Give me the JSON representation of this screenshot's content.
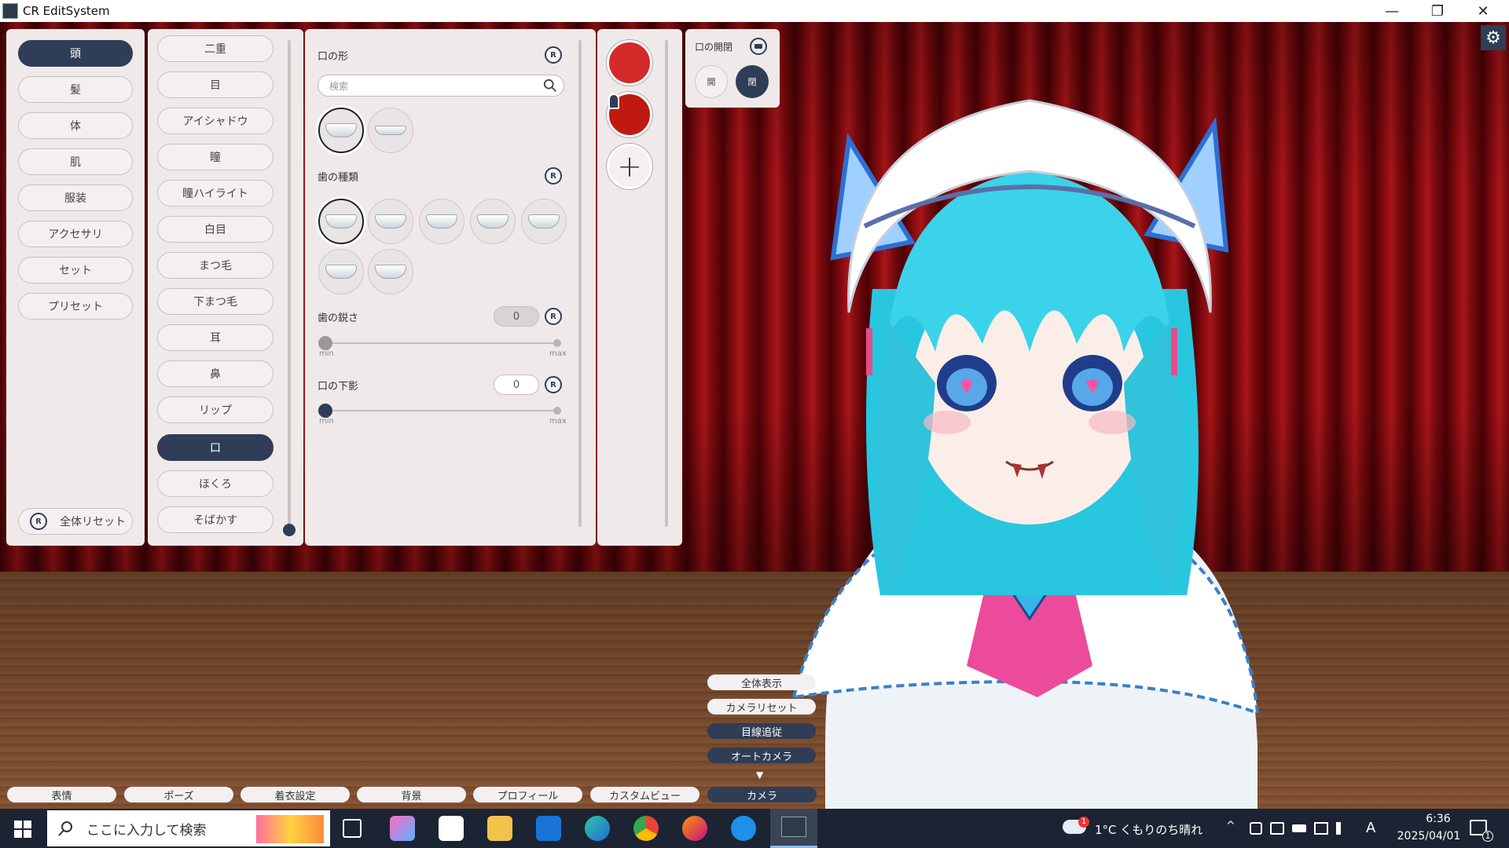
{
  "window": {
    "title": "CR EditSystem",
    "minimize": "—",
    "maximize": "❐",
    "close": "✕"
  },
  "categories": [
    "頭",
    "髪",
    "体",
    "肌",
    "服装",
    "アクセサリ",
    "セット",
    "プリセット"
  ],
  "category_active": 0,
  "full_reset": "全体リセット",
  "parts": [
    "二重",
    "目",
    "アイシャドウ",
    "瞳",
    "瞳ハイライト",
    "白目",
    "まつ毛",
    "下まつ毛",
    "耳",
    "鼻",
    "リップ",
    "口",
    "ほくろ",
    "そばかす"
  ],
  "part_active": 11,
  "detail": {
    "mouth_shape_title": "口の形",
    "search_placeholder": "検索",
    "teeth_type_title": "歯の種類",
    "sharpness_title": "歯の鋭さ",
    "sharpness_value": "0",
    "shadow_title": "口の下影",
    "shadow_value": "0",
    "min_label": "min",
    "max_label": "max",
    "reset_glyph": "R"
  },
  "colors": {
    "swatch1": "#d42a2a",
    "swatch2": "#c01a10",
    "accent": "#2f3d56"
  },
  "add_symbol": "+",
  "mouth_open": {
    "title": "口の開閉",
    "open": "開",
    "close": "閉"
  },
  "camera_menu": [
    "全体表示",
    "カメラリセット",
    "目線追従",
    "オートカメラ"
  ],
  "camera_arrow": "▼",
  "bottom_tabs": [
    "表情",
    "ポーズ",
    "着衣設定",
    "背景",
    "プロフィール",
    "カスタムビュー",
    "カメラ"
  ],
  "taskbar": {
    "search_placeholder": "ここに入力して検索",
    "weather": "1°C くもりのち晴れ",
    "weather_badge": "1",
    "ime": "A",
    "time": "6:36",
    "date": "2025/04/01",
    "notif_count": "1",
    "tray_chevron": "^"
  },
  "settings_icon": "⚙"
}
